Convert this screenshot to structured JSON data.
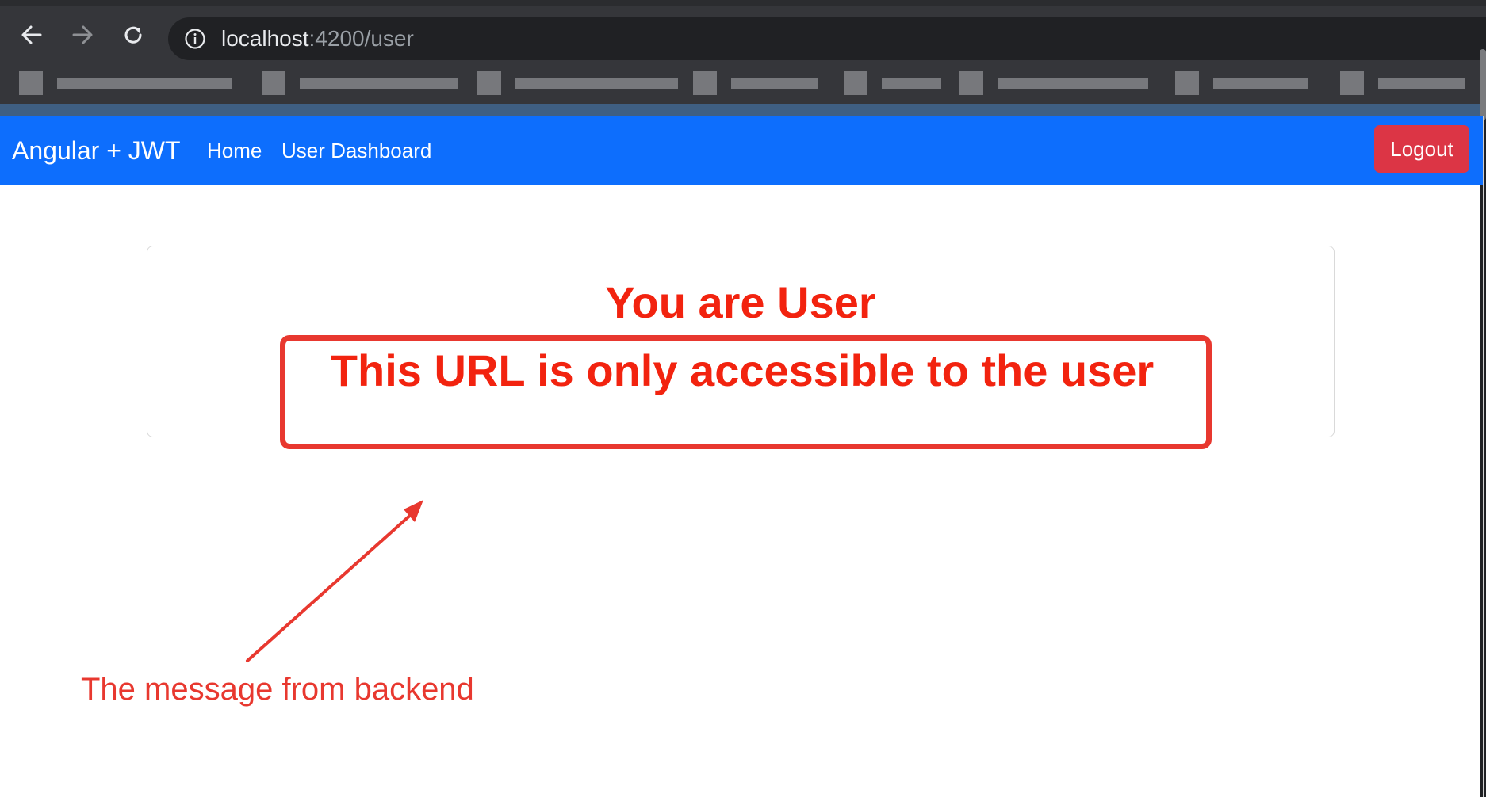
{
  "browser": {
    "url_host": "localhost",
    "url_path": ":4200/user",
    "icons": [
      "back-arrow-icon",
      "forward-arrow-icon",
      "reload-icon",
      "info-icon"
    ]
  },
  "navbar": {
    "brand": "Angular + JWT",
    "links": [
      "Home",
      "User Dashboard"
    ],
    "logout_label": "Logout",
    "color": "#0d6efd",
    "logout_color": "#dc3545"
  },
  "card": {
    "title": "You are User",
    "message": "This URL is only accessible to the user",
    "text_color": "#f2230f"
  },
  "annotation": {
    "label": "The message from backend",
    "color": "#e8382f"
  }
}
